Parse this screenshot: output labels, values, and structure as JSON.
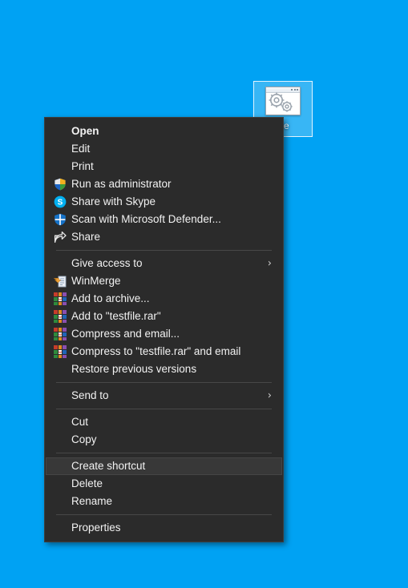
{
  "desktop": {
    "background_color": "#00a2f3",
    "icon": {
      "label": "file",
      "icon_name": "application-gears-icon",
      "selected": true
    }
  },
  "context_menu": {
    "highlight_color": "#383838",
    "background_color": "#2b2b2b",
    "text_color": "#f2f2f2",
    "groups": [
      {
        "items": [
          {
            "label": "Open",
            "icon": "",
            "bold": true,
            "submenu": false,
            "highlighted": false
          },
          {
            "label": "Edit",
            "icon": "",
            "bold": false,
            "submenu": false,
            "highlighted": false
          },
          {
            "label": "Print",
            "icon": "",
            "bold": false,
            "submenu": false,
            "highlighted": false
          },
          {
            "label": "Run as administrator",
            "icon": "uac-shield-icon",
            "bold": false,
            "submenu": false,
            "highlighted": false
          },
          {
            "label": "Share with Skype",
            "icon": "skype-icon",
            "bold": false,
            "submenu": false,
            "highlighted": false
          },
          {
            "label": "Scan with Microsoft Defender...",
            "icon": "defender-shield-icon",
            "bold": false,
            "submenu": false,
            "highlighted": false
          },
          {
            "label": "Share",
            "icon": "share-icon",
            "bold": false,
            "submenu": false,
            "highlighted": false
          }
        ]
      },
      {
        "items": [
          {
            "label": "Give access to",
            "icon": "",
            "bold": false,
            "submenu": true,
            "highlighted": false
          },
          {
            "label": "WinMerge",
            "icon": "winmerge-icon",
            "bold": false,
            "submenu": false,
            "highlighted": false
          },
          {
            "label": "Add to archive...",
            "icon": "winrar-icon",
            "bold": false,
            "submenu": false,
            "highlighted": false
          },
          {
            "label": "Add to \"testfile.rar\"",
            "icon": "winrar-icon",
            "bold": false,
            "submenu": false,
            "highlighted": false
          },
          {
            "label": "Compress and email...",
            "icon": "winrar-icon",
            "bold": false,
            "submenu": false,
            "highlighted": false
          },
          {
            "label": "Compress to \"testfile.rar\" and email",
            "icon": "winrar-icon",
            "bold": false,
            "submenu": false,
            "highlighted": false
          },
          {
            "label": "Restore previous versions",
            "icon": "",
            "bold": false,
            "submenu": false,
            "highlighted": false
          }
        ]
      },
      {
        "items": [
          {
            "label": "Send to",
            "icon": "",
            "bold": false,
            "submenu": true,
            "highlighted": false
          }
        ]
      },
      {
        "items": [
          {
            "label": "Cut",
            "icon": "",
            "bold": false,
            "submenu": false,
            "highlighted": false
          },
          {
            "label": "Copy",
            "icon": "",
            "bold": false,
            "submenu": false,
            "highlighted": false
          }
        ]
      },
      {
        "items": [
          {
            "label": "Create shortcut",
            "icon": "",
            "bold": false,
            "submenu": false,
            "highlighted": true
          },
          {
            "label": "Delete",
            "icon": "",
            "bold": false,
            "submenu": false,
            "highlighted": false
          },
          {
            "label": "Rename",
            "icon": "",
            "bold": false,
            "submenu": false,
            "highlighted": false
          }
        ]
      },
      {
        "items": [
          {
            "label": "Properties",
            "icon": "",
            "bold": false,
            "submenu": false,
            "highlighted": false
          }
        ]
      }
    ],
    "submenu_glyph": "›"
  }
}
